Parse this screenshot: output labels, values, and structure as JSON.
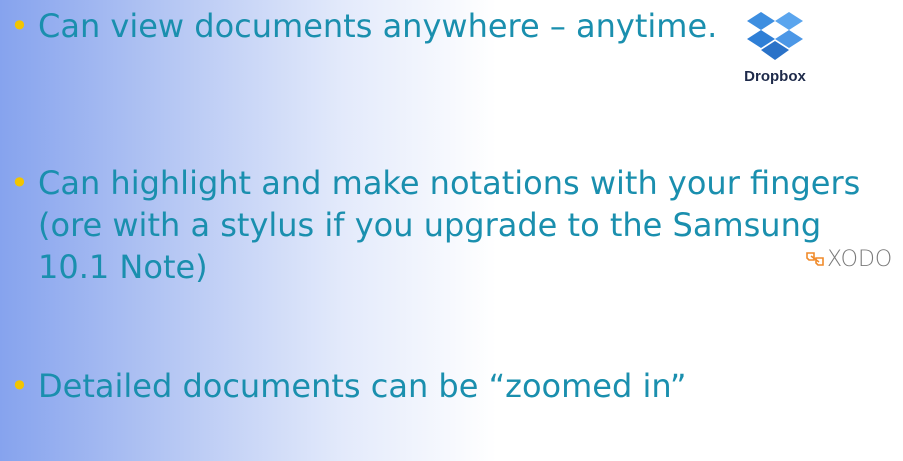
{
  "bullets": [
    {
      "bullet_glyph": "•",
      "text": "Can view documents anywhere – anytime."
    },
    {
      "bullet_glyph": "•",
      "text": "Can highlight and make notations with your fingers (ore with a stylus if you upgrade to the Samsung 10.1 Note)"
    },
    {
      "bullet_glyph": "•",
      "text": "Detailed documents can be “zoomed in”"
    }
  ],
  "logos": {
    "dropbox": {
      "label": "Dropbox",
      "icon": "dropbox-box-icon",
      "color": "#3d8ee0"
    },
    "xodo": {
      "label": "XODO",
      "icon": "xodo-icon",
      "color": "#f08a2a"
    }
  },
  "colors": {
    "text": "#1a8fae",
    "bullet": "#f2c500"
  }
}
